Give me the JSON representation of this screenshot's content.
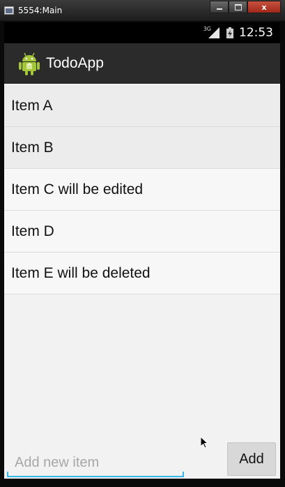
{
  "window": {
    "title": "5554:Main",
    "controls": {
      "minimize_icon": "minimize-icon",
      "maximize_icon": "maximize-icon",
      "close_label": "x"
    }
  },
  "statusbar": {
    "network_type": "3G",
    "clock": "12:53"
  },
  "actionbar": {
    "app_icon": "android-robot-icon",
    "title": "TodoApp"
  },
  "list": {
    "items": [
      {
        "label": "Item A",
        "shaded": true
      },
      {
        "label": "Item B",
        "shaded": true
      },
      {
        "label": "Item C will be edited",
        "shaded": false
      },
      {
        "label": "Item D",
        "shaded": false
      },
      {
        "label": "Item E will be deleted",
        "shaded": false
      }
    ]
  },
  "footer": {
    "input_value": "",
    "input_placeholder": "Add new item",
    "add_label": "Add"
  },
  "colors": {
    "accent": "#33b5e5",
    "actionbar": "#2b2b2b",
    "android_green": "#a4c639"
  }
}
